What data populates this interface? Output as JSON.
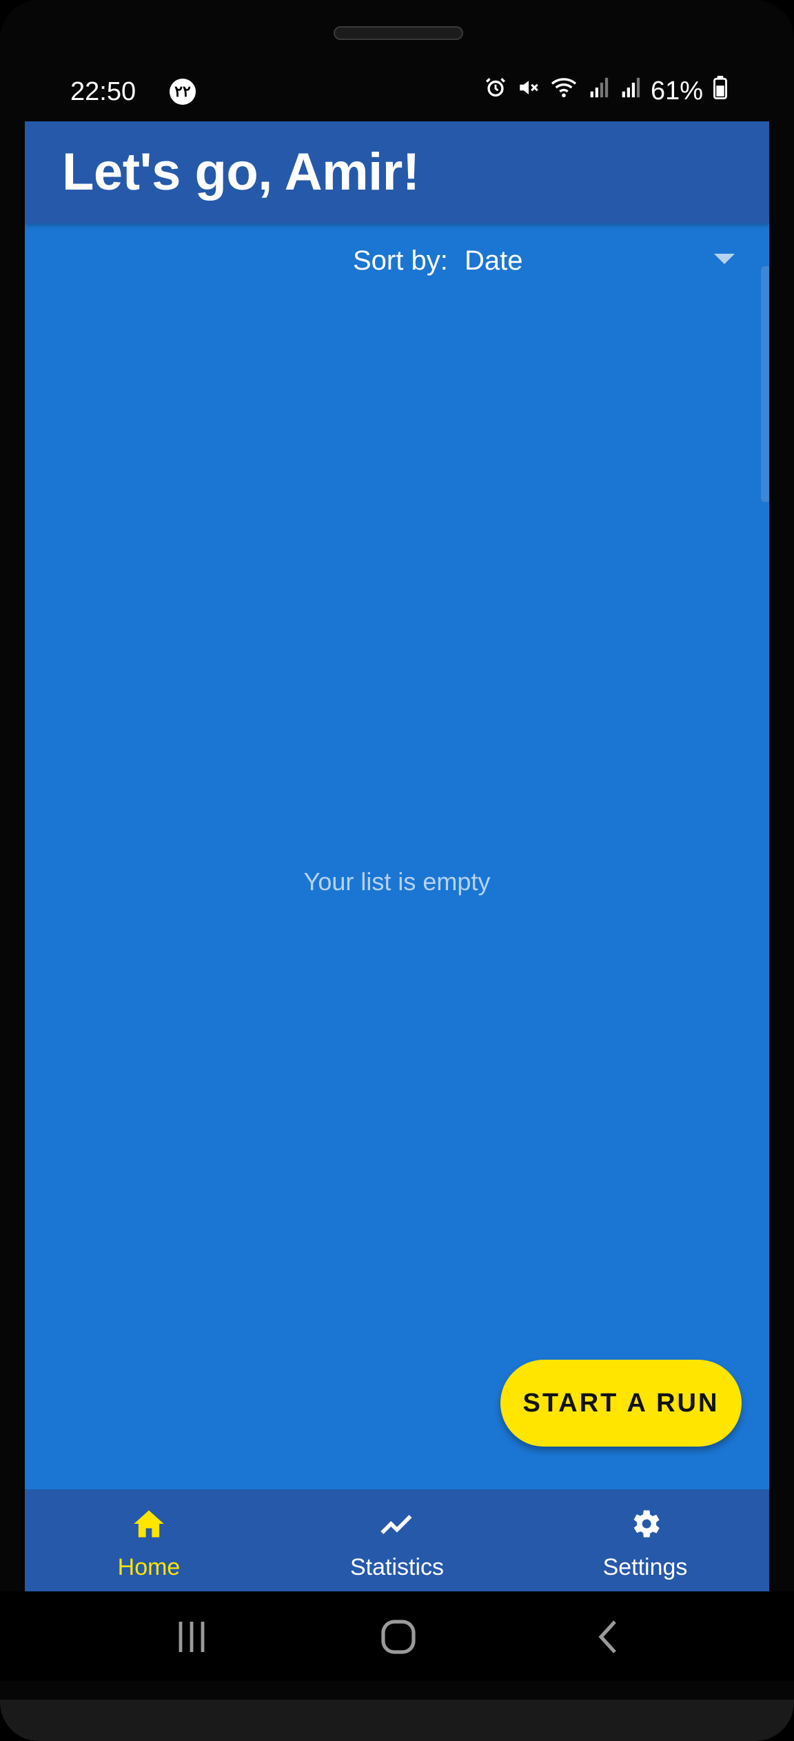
{
  "status_bar": {
    "time": "22:50",
    "date_badge": "۲۲",
    "battery": "61%",
    "icons": [
      "alarm-icon",
      "mute-icon",
      "wifi-icon",
      "signal-icon",
      "signal-icon",
      "battery-icon"
    ]
  },
  "app_bar": {
    "title": "Let's go, Amir!"
  },
  "sort": {
    "label": "Sort by:",
    "value": "Date"
  },
  "list": {
    "empty_text": "Your list is empty"
  },
  "fab": {
    "label": "START A RUN"
  },
  "bottom_nav": {
    "items": [
      {
        "label": "Home",
        "icon": "home-icon",
        "active": true
      },
      {
        "label": "Statistics",
        "icon": "chart-line-icon",
        "active": false
      },
      {
        "label": "Settings",
        "icon": "gear-icon",
        "active": false
      }
    ]
  },
  "system_nav": {
    "buttons": [
      "recent-apps-icon",
      "home-button-icon",
      "back-icon"
    ]
  },
  "colors": {
    "background": "#1b76d3",
    "app_bar": "#2659aa",
    "accent": "#ffe500"
  }
}
